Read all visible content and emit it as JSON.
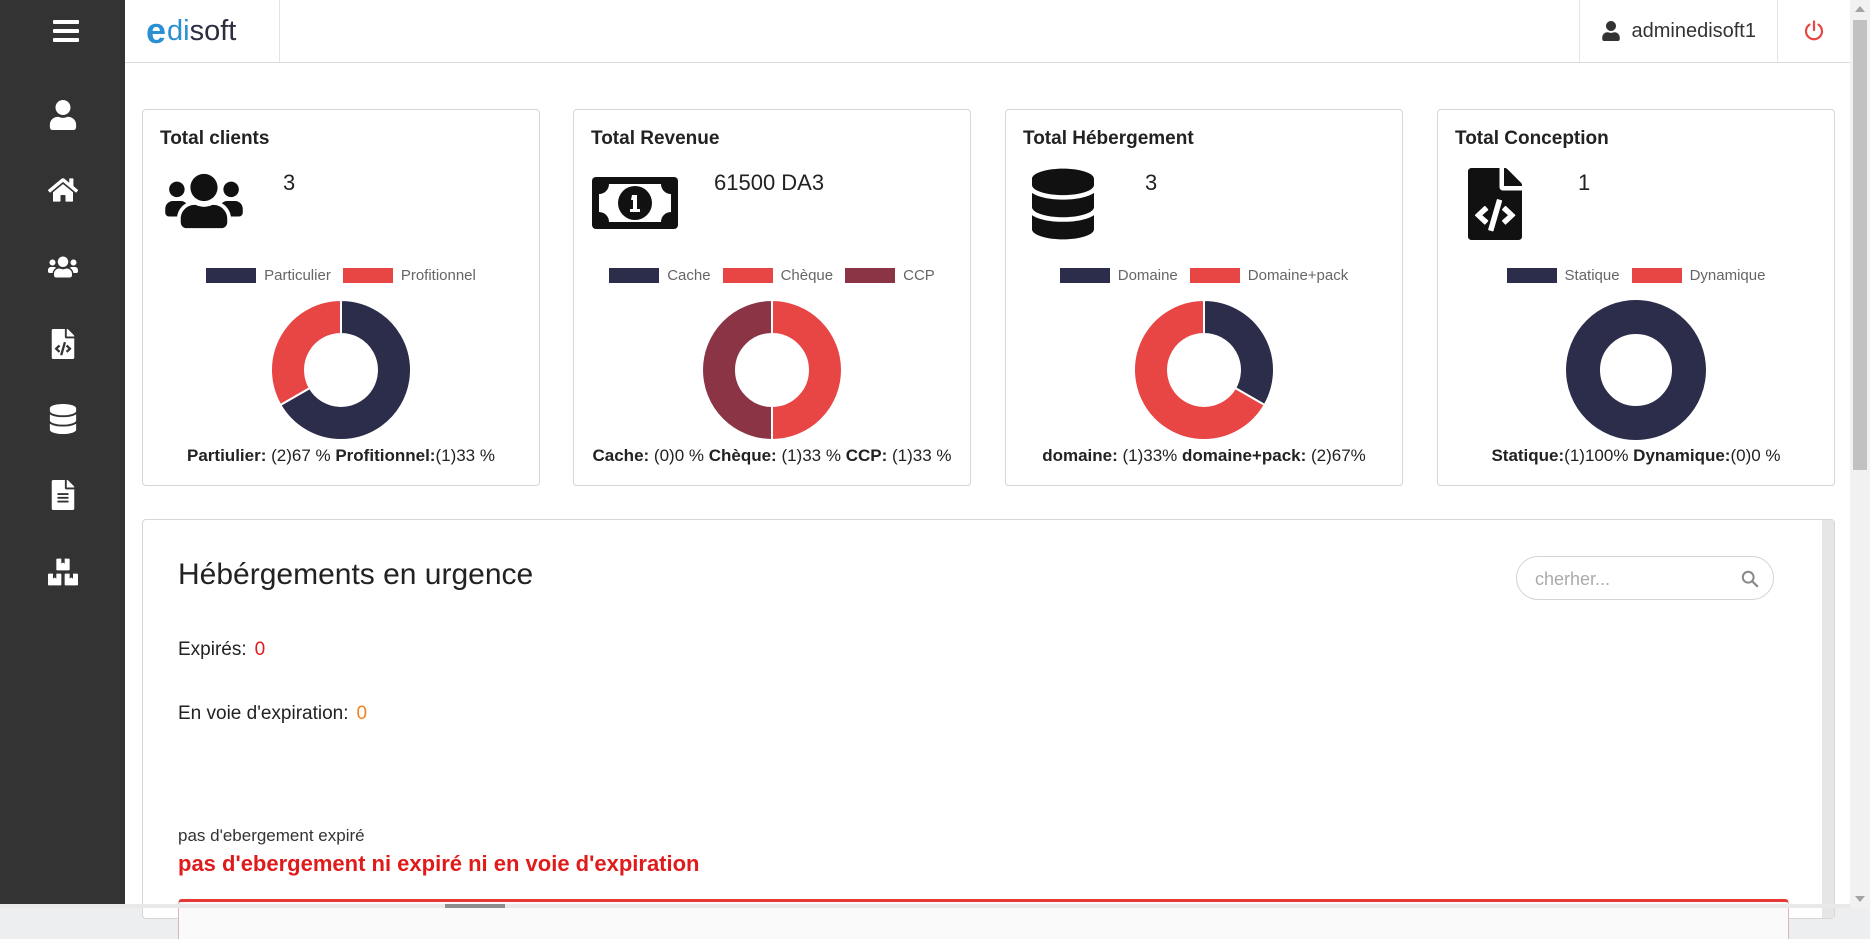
{
  "app": {
    "brand_e": "e",
    "brand_di": "di",
    "brand_soft": "soft",
    "username": "adminedisoft1"
  },
  "colors": {
    "navy": "#2b2d4a",
    "red": "#e84545",
    "maroon": "#8b3446",
    "orange": "#f5821f",
    "alert_red": "#e01b1b"
  },
  "sidebar": {
    "icons": [
      "user-icon",
      "home-icon",
      "users-icon",
      "file-code-icon",
      "database-icon",
      "file-text-icon",
      "boxes-icon"
    ]
  },
  "cards": [
    {
      "title": "Total clients",
      "value": "3",
      "icon": "users-icon",
      "legend": [
        "Particulier",
        "Profitionnel"
      ],
      "stats": [
        {
          "label": "Partiulier:",
          "value": " (2)67 %"
        },
        {
          "label": " Profitionnel:",
          "value": "(1)33 %"
        }
      ],
      "chart_data": {
        "type": "pie",
        "categories": [
          "Particulier",
          "Profitionnel"
        ],
        "values": [
          2,
          1
        ],
        "colors": [
          "#2b2d4a",
          "#e84545"
        ]
      }
    },
    {
      "title": "Total Revenue",
      "value": "61500 DA3",
      "icon": "money-bill-icon",
      "legend": [
        "Cache",
        "Chèque",
        "CCP"
      ],
      "stats": [
        {
          "label": "Cache:",
          "value": " (0)0 %"
        },
        {
          "label": " Chèque:",
          "value": " (1)33 %"
        },
        {
          "label": " CCP:",
          "value": " (1)33 %"
        }
      ],
      "chart_data": {
        "type": "pie",
        "categories": [
          "Cache",
          "Chèque",
          "CCP"
        ],
        "values": [
          0,
          1,
          1
        ],
        "colors": [
          "#2b2d4a",
          "#e84545",
          "#8b3446"
        ]
      }
    },
    {
      "title": "Total Hébergement",
      "value": "3",
      "icon": "database-icon",
      "legend": [
        "Domaine",
        "Domaine+pack"
      ],
      "stats": [
        {
          "label": "domaine:",
          "value": " (1)33%"
        },
        {
          "label": " domaine+pack:",
          "value": " (2)67%"
        }
      ],
      "chart_data": {
        "type": "pie",
        "categories": [
          "Domaine",
          "Domaine+pack"
        ],
        "values": [
          1,
          2
        ],
        "colors": [
          "#2b2d4a",
          "#e84545"
        ]
      }
    },
    {
      "title": "Total Conception",
      "value": "1",
      "icon": "file-code-icon",
      "legend": [
        "Statique",
        "Dynamique"
      ],
      "stats": [
        {
          "label": "Statique:",
          "value": "(1)100%"
        },
        {
          "label": " Dynamique:",
          "value": "(0)0 %"
        }
      ],
      "chart_data": {
        "type": "pie",
        "categories": [
          "Statique",
          "Dynamique"
        ],
        "values": [
          1,
          0
        ],
        "colors": [
          "#2b2d4a",
          "#e84545"
        ]
      }
    }
  ],
  "panel": {
    "title": "Hébérgements en urgence",
    "search_placeholder": "cherher...",
    "expired_label": "Expirés:",
    "expired_value": "0",
    "expiring_label": "En voie d'expiration:",
    "expiring_value": "0",
    "note": "pas d'ebergement expiré",
    "alert": "pas d'ebergement ni expiré ni en voie d'expiration"
  }
}
